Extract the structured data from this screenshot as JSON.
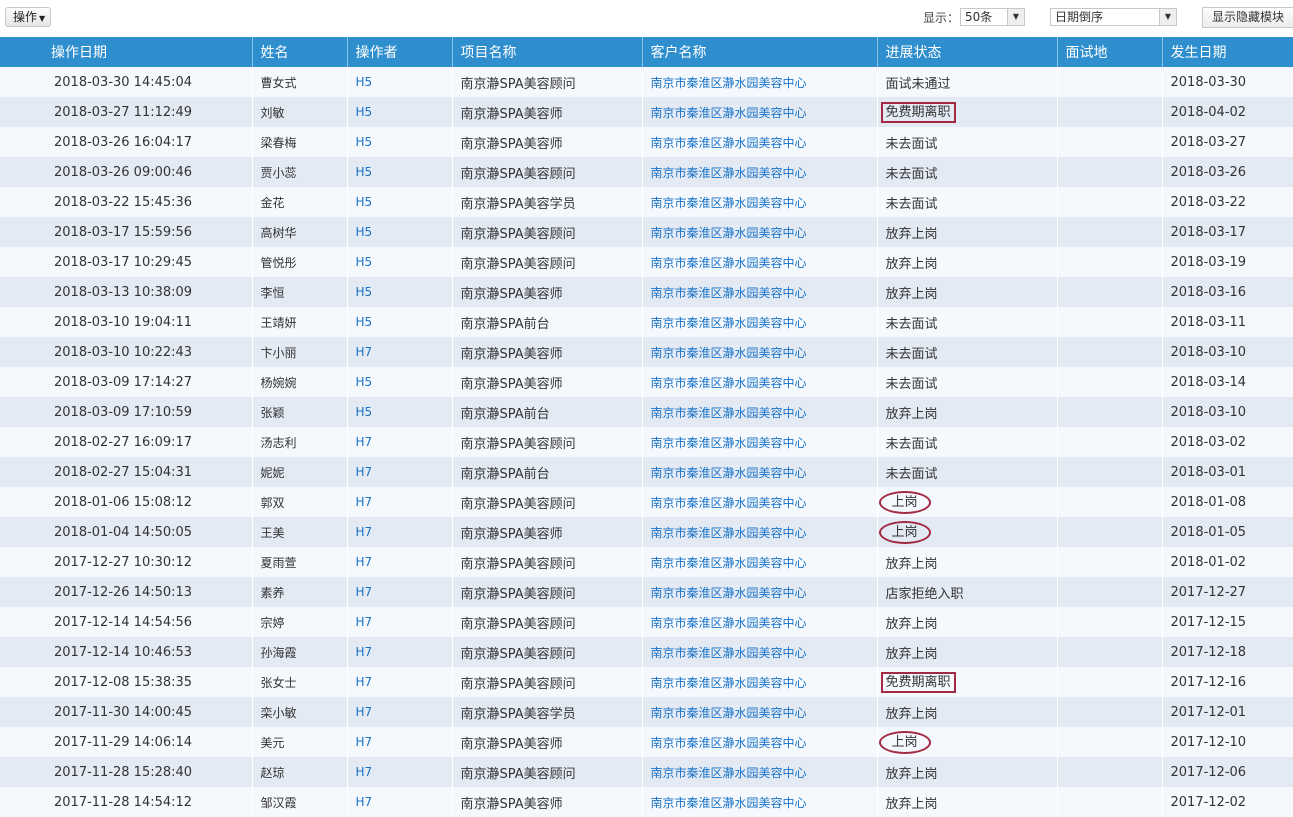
{
  "toolbar": {
    "op_label": "操作",
    "display_label": "显示：",
    "count_value": "50条",
    "sort_value": "日期倒序",
    "toggle_label": "显示隐藏模块"
  },
  "columns": [
    "操作日期",
    "姓名",
    "操作者",
    "项目名称",
    "客户名称",
    "进展状态",
    "面试地",
    "发生日期"
  ],
  "rows": [
    {
      "op_date": "2018-03-30 14:45:04",
      "name": "曹女式",
      "operator": "H5",
      "project": "南京瀞SPA美容顾问",
      "client": "南京市秦淮区瀞水园美容中心",
      "status": "面试未通过",
      "interview": "",
      "occur_date": "2018-03-30",
      "mark": ""
    },
    {
      "op_date": "2018-03-27 11:12:49",
      "name": "刘敏",
      "operator": "H5",
      "project": "南京瀞SPA美容师",
      "client": "南京市秦淮区瀞水园美容中心",
      "status": "免费期离职",
      "interview": "",
      "occur_date": "2018-04-02",
      "mark": "box"
    },
    {
      "op_date": "2018-03-26 16:04:17",
      "name": "梁春梅",
      "operator": "H5",
      "project": "南京瀞SPA美容师",
      "client": "南京市秦淮区瀞水园美容中心",
      "status": "未去面试",
      "interview": "",
      "occur_date": "2018-03-27",
      "mark": ""
    },
    {
      "op_date": "2018-03-26 09:00:46",
      "name": "贾小蕊",
      "operator": "H5",
      "project": "南京瀞SPA美容顾问",
      "client": "南京市秦淮区瀞水园美容中心",
      "status": "未去面试",
      "interview": "",
      "occur_date": "2018-03-26",
      "mark": ""
    },
    {
      "op_date": "2018-03-22 15:45:36",
      "name": "金花",
      "operator": "H5",
      "project": "南京瀞SPA美容学员",
      "client": "南京市秦淮区瀞水园美容中心",
      "status": "未去面试",
      "interview": "",
      "occur_date": "2018-03-22",
      "mark": ""
    },
    {
      "op_date": "2018-03-17 15:59:56",
      "name": "高树华",
      "operator": "H5",
      "project": "南京瀞SPA美容顾问",
      "client": "南京市秦淮区瀞水园美容中心",
      "status": "放弃上岗",
      "interview": "",
      "occur_date": "2018-03-17",
      "mark": ""
    },
    {
      "op_date": "2018-03-17 10:29:45",
      "name": "管悦彤",
      "operator": "H5",
      "project": "南京瀞SPA美容顾问",
      "client": "南京市秦淮区瀞水园美容中心",
      "status": "放弃上岗",
      "interview": "",
      "occur_date": "2018-03-19",
      "mark": ""
    },
    {
      "op_date": "2018-03-13 10:38:09",
      "name": "李恒",
      "operator": "H5",
      "project": "南京瀞SPA美容师",
      "client": "南京市秦淮区瀞水园美容中心",
      "status": "放弃上岗",
      "interview": "",
      "occur_date": "2018-03-16",
      "mark": ""
    },
    {
      "op_date": "2018-03-10 19:04:11",
      "name": "王靖妍",
      "operator": "H5",
      "project": "南京瀞SPA前台",
      "client": "南京市秦淮区瀞水园美容中心",
      "status": "未去面试",
      "interview": "",
      "occur_date": "2018-03-11",
      "mark": ""
    },
    {
      "op_date": "2018-03-10 10:22:43",
      "name": "卞小丽",
      "operator": "H7",
      "project": "南京瀞SPA美容师",
      "client": "南京市秦淮区瀞水园美容中心",
      "status": "未去面试",
      "interview": "",
      "occur_date": "2018-03-10",
      "mark": ""
    },
    {
      "op_date": "2018-03-09 17:14:27",
      "name": "杨婉婉",
      "operator": "H5",
      "project": "南京瀞SPA美容师",
      "client": "南京市秦淮区瀞水园美容中心",
      "status": "未去面试",
      "interview": "",
      "occur_date": "2018-03-14",
      "mark": ""
    },
    {
      "op_date": "2018-03-09 17:10:59",
      "name": "张颖",
      "operator": "H5",
      "project": "南京瀞SPA前台",
      "client": "南京市秦淮区瀞水园美容中心",
      "status": "放弃上岗",
      "interview": "",
      "occur_date": "2018-03-10",
      "mark": ""
    },
    {
      "op_date": "2018-02-27 16:09:17",
      "name": "汤志利",
      "operator": "H7",
      "project": "南京瀞SPA美容顾问",
      "client": "南京市秦淮区瀞水园美容中心",
      "status": "未去面试",
      "interview": "",
      "occur_date": "2018-03-02",
      "mark": ""
    },
    {
      "op_date": "2018-02-27 15:04:31",
      "name": "妮妮",
      "operator": "H7",
      "project": "南京瀞SPA前台",
      "client": "南京市秦淮区瀞水园美容中心",
      "status": "未去面试",
      "interview": "",
      "occur_date": "2018-03-01",
      "mark": ""
    },
    {
      "op_date": "2018-01-06 15:08:12",
      "name": "郭双",
      "operator": "H7",
      "project": "南京瀞SPA美容顾问",
      "client": "南京市秦淮区瀞水园美容中心",
      "status": "上岗",
      "interview": "",
      "occur_date": "2018-01-08",
      "mark": "oval"
    },
    {
      "op_date": "2018-01-04 14:50:05",
      "name": "王美",
      "operator": "H7",
      "project": "南京瀞SPA美容师",
      "client": "南京市秦淮区瀞水园美容中心",
      "status": "上岗",
      "interview": "",
      "occur_date": "2018-01-05",
      "mark": "oval"
    },
    {
      "op_date": "2017-12-27 10:30:12",
      "name": "夏雨萱",
      "operator": "H7",
      "project": "南京瀞SPA美容顾问",
      "client": "南京市秦淮区瀞水园美容中心",
      "status": "放弃上岗",
      "interview": "",
      "occur_date": "2018-01-02",
      "mark": ""
    },
    {
      "op_date": "2017-12-26 14:50:13",
      "name": "素养",
      "operator": "H7",
      "project": "南京瀞SPA美容顾问",
      "client": "南京市秦淮区瀞水园美容中心",
      "status": "店家拒绝入职",
      "interview": "",
      "occur_date": "2017-12-27",
      "mark": ""
    },
    {
      "op_date": "2017-12-14 14:54:56",
      "name": "宗婷",
      "operator": "H7",
      "project": "南京瀞SPA美容顾问",
      "client": "南京市秦淮区瀞水园美容中心",
      "status": "放弃上岗",
      "interview": "",
      "occur_date": "2017-12-15",
      "mark": ""
    },
    {
      "op_date": "2017-12-14 10:46:53",
      "name": "孙海霞",
      "operator": "H7",
      "project": "南京瀞SPA美容顾问",
      "client": "南京市秦淮区瀞水园美容中心",
      "status": "放弃上岗",
      "interview": "",
      "occur_date": "2017-12-18",
      "mark": ""
    },
    {
      "op_date": "2017-12-08 15:38:35",
      "name": "张女士",
      "operator": "H7",
      "project": "南京瀞SPA美容顾问",
      "client": "南京市秦淮区瀞水园美容中心",
      "status": "免费期离职",
      "interview": "",
      "occur_date": "2017-12-16",
      "mark": "box"
    },
    {
      "op_date": "2017-11-30 14:00:45",
      "name": "栾小敏",
      "operator": "H7",
      "project": "南京瀞SPA美容学员",
      "client": "南京市秦淮区瀞水园美容中心",
      "status": "放弃上岗",
      "interview": "",
      "occur_date": "2017-12-01",
      "mark": ""
    },
    {
      "op_date": "2017-11-29 14:06:14",
      "name": "美元",
      "operator": "H7",
      "project": "南京瀞SPA美容师",
      "client": "南京市秦淮区瀞水园美容中心",
      "status": "上岗",
      "interview": "",
      "occur_date": "2017-12-10",
      "mark": "oval"
    },
    {
      "op_date": "2017-11-28 15:28:40",
      "name": "赵琼",
      "operator": "H7",
      "project": "南京瀞SPA美容顾问",
      "client": "南京市秦淮区瀞水园美容中心",
      "status": "放弃上岗",
      "interview": "",
      "occur_date": "2017-12-06",
      "mark": ""
    },
    {
      "op_date": "2017-11-28 14:54:12",
      "name": "邹汉霞",
      "operator": "H7",
      "project": "南京瀞SPA美容师",
      "client": "南京市秦淮区瀞水园美容中心",
      "status": "放弃上岗",
      "interview": "",
      "occur_date": "2017-12-02",
      "mark": ""
    }
  ],
  "colors": {
    "header_bg": "#2f8fce",
    "row_light": "#f5f8fc",
    "row_dark": "#e3eaf4",
    "link": "#1a73c8",
    "highlight": "#a22a44"
  },
  "icons": {
    "op_caret": "caret-down-icon",
    "select_arrow": "chevron-down-icon"
  }
}
